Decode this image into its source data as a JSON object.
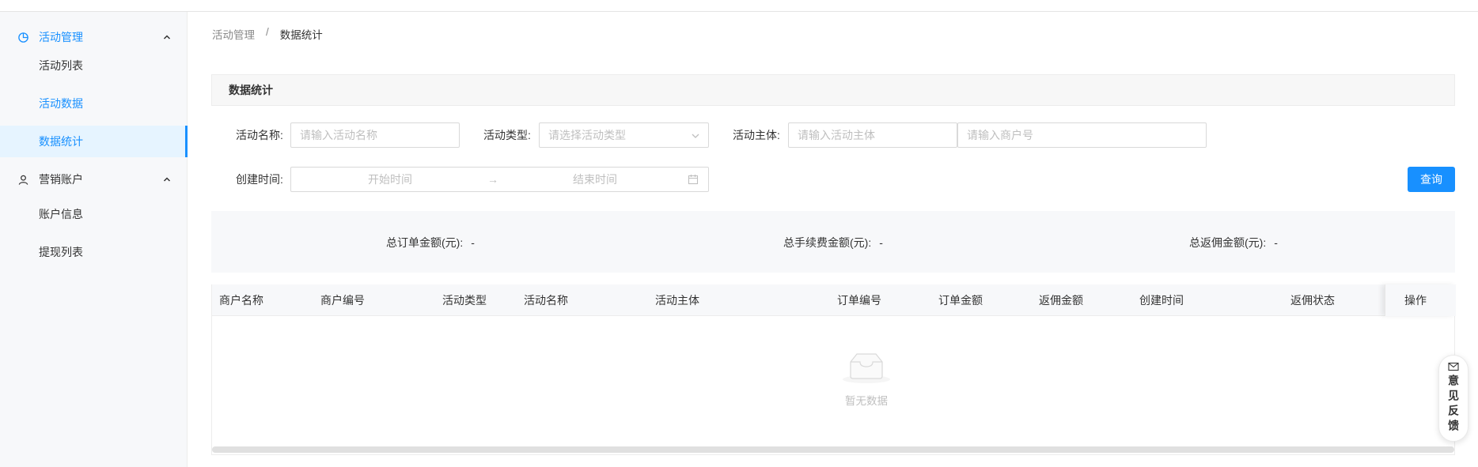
{
  "sidebar": {
    "groups": [
      {
        "label": "活动管理",
        "icon": "pie-chart-icon"
      },
      {
        "label": "营销账户",
        "icon": "user-icon"
      }
    ],
    "items": [
      {
        "label": "活动列表"
      },
      {
        "label": "活动数据"
      },
      {
        "label": "数据统计"
      },
      {
        "label": "账户信息"
      },
      {
        "label": "提现列表"
      }
    ]
  },
  "breadcrumb": {
    "parent": "活动管理",
    "separator": "/",
    "current": "数据统计"
  },
  "card": {
    "title": "数据统计"
  },
  "filters": {
    "name_label": "活动名称:",
    "name_placeholder": "请输入活动名称",
    "type_label": "活动类型:",
    "type_placeholder": "请选择活动类型",
    "subject_label": "活动主体:",
    "subject_placeholder": "请输入活动主体",
    "merchant_placeholder": "请输入商户号",
    "time_label": "创建时间:",
    "start_placeholder": "开始时间",
    "range_separator": "→",
    "end_placeholder": "结束时间",
    "query_label": "查询"
  },
  "summary": [
    {
      "label": "总订单金额(元):",
      "value": "-"
    },
    {
      "label": "总手续费金额(元):",
      "value": "-"
    },
    {
      "label": "总返佣金额(元):",
      "value": "-"
    }
  ],
  "table": {
    "columns": [
      "商户名称",
      "商户编号",
      "活动类型",
      "活动名称",
      "活动主体",
      "订单编号",
      "订单金额",
      "返佣金额",
      "创建时间",
      "返佣状态",
      "操作"
    ],
    "empty_text": "暂无数据"
  },
  "feedback": {
    "label": "意见反馈"
  },
  "colors": {
    "accent": "#1890ff",
    "sidebar_bg": "#f7f8fa"
  }
}
